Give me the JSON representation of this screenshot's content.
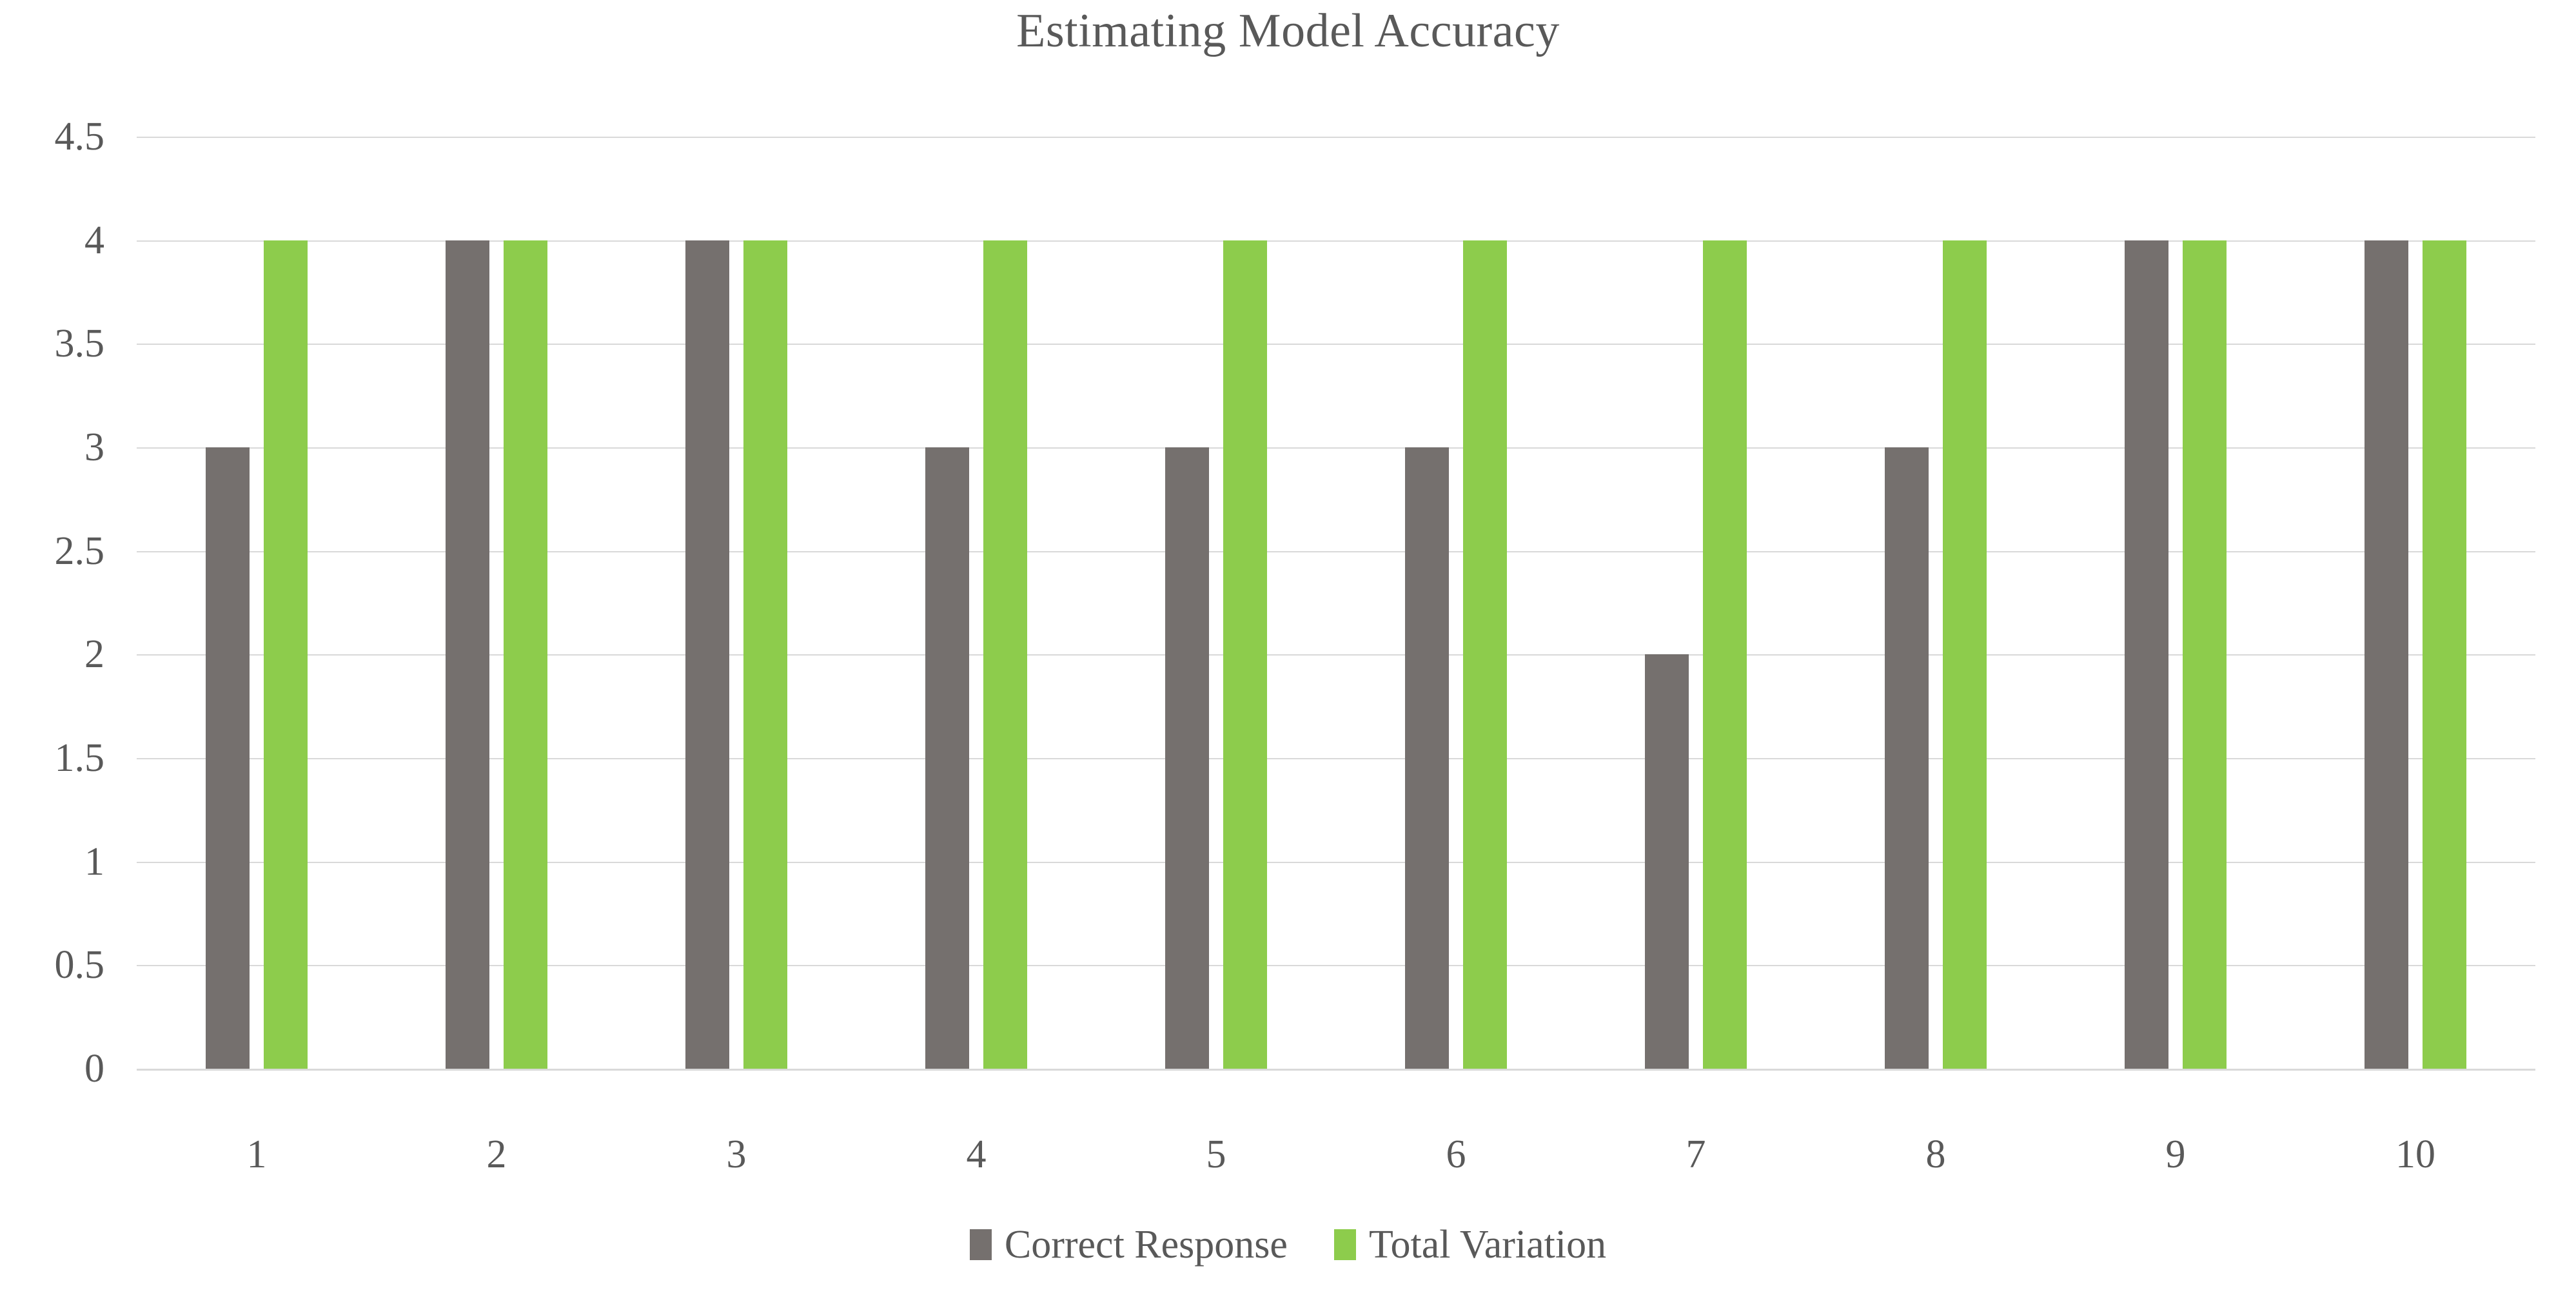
{
  "chart_data": {
    "type": "bar",
    "title": "Estimating Model Accuracy",
    "xlabel": "",
    "ylabel": "",
    "categories": [
      "1",
      "2",
      "3",
      "4",
      "5",
      "6",
      "7",
      "8",
      "9",
      "10"
    ],
    "series": [
      {
        "name": "Correct Response",
        "color": "#75706E",
        "values": [
          3,
          4,
          4,
          3,
          3,
          3,
          2,
          3,
          4,
          4
        ]
      },
      {
        "name": "Total Variation",
        "color": "#8DCC4C",
        "values": [
          4,
          4,
          4,
          4,
          4,
          4,
          4,
          4,
          4,
          4
        ]
      }
    ],
    "ylim": [
      0,
      4.5
    ],
    "y_ticks": [
      "0",
      "0.5",
      "1",
      "1.5",
      "2",
      "2.5",
      "3",
      "3.5",
      "4",
      "4.5"
    ],
    "y_tick_values": [
      0,
      0.5,
      1,
      1.5,
      2,
      2.5,
      3,
      3.5,
      4,
      4.5
    ],
    "grid": true,
    "legend_position": "bottom",
    "background_color": "#FFFFFF",
    "gridline_color": "#D9D9D9",
    "text_color": "#595959"
  }
}
